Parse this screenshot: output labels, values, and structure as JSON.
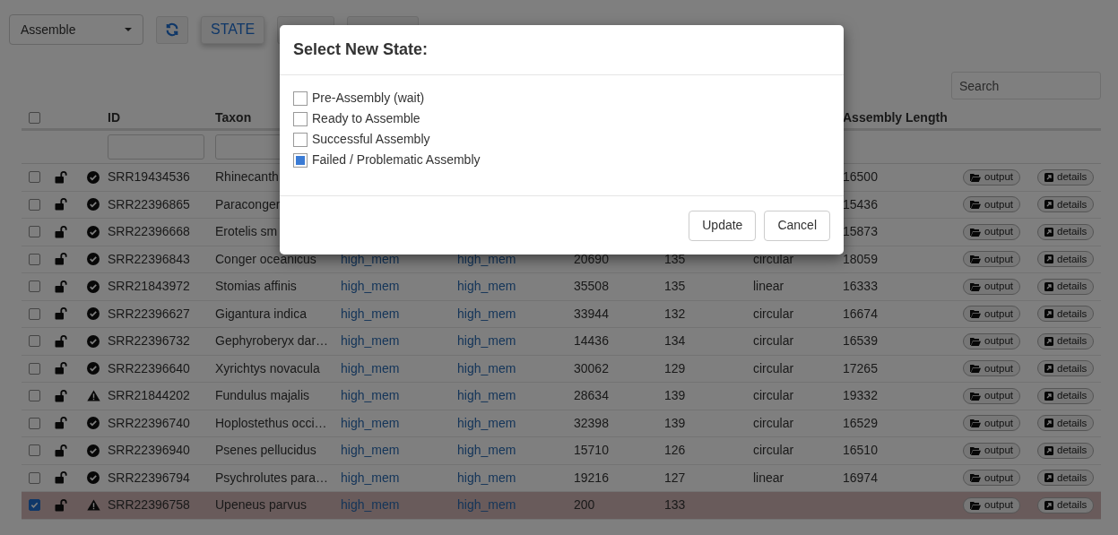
{
  "toolbar": {
    "mode_select": "Assemble",
    "buttons": [
      "STATE"
    ]
  },
  "search": {
    "placeholder": "Search"
  },
  "table": {
    "columns": {
      "id": "ID",
      "taxon": "Taxon",
      "assembly_length": "Assembly Length"
    },
    "select_all_checked": false,
    "rows": [
      {
        "selected": false,
        "locked": false,
        "warning": false,
        "id": "SRR19434536",
        "taxon": "Rhinecanth",
        "assembly_length": "16500",
        "output": "output",
        "details": "details"
      },
      {
        "selected": false,
        "locked": false,
        "warning": false,
        "id": "SRR22396865",
        "taxon": "Paraconger",
        "assembly_length": "15436",
        "output": "output",
        "details": "details"
      },
      {
        "selected": false,
        "locked": false,
        "warning": false,
        "id": "SRR22396668",
        "taxon": "Erotelis sm",
        "assembly_length": "15873",
        "output": "output",
        "details": "details"
      },
      {
        "selected": false,
        "locked": false,
        "warning": false,
        "id": "SRR22396843",
        "taxon": "Conger oceanicus",
        "column_6": "high_mem",
        "column_7": "high_mem",
        "column_8": "20690",
        "column_9": "135",
        "column_10": "circular",
        "assembly_length": "18059",
        "output": "output",
        "details": "details"
      },
      {
        "selected": false,
        "locked": false,
        "warning": false,
        "id": "SRR21843972",
        "taxon": "Stomias affinis",
        "column_6": "high_mem",
        "column_7": "high_mem",
        "column_8": "35508",
        "column_9": "135",
        "column_10": "linear",
        "assembly_length": "16333",
        "output": "output",
        "details": "details"
      },
      {
        "selected": false,
        "locked": false,
        "warning": false,
        "id": "SRR22396627",
        "taxon": "Gigantura indica",
        "column_6": "high_mem",
        "column_7": "high_mem",
        "column_8": "33944",
        "column_9": "132",
        "column_10": "circular",
        "assembly_length": "16674",
        "output": "output",
        "details": "details"
      },
      {
        "selected": false,
        "locked": false,
        "warning": false,
        "id": "SRR22396732",
        "taxon": "Gephyroberyx dar…",
        "column_6": "high_mem",
        "column_7": "high_mem",
        "column_8": "14436",
        "column_9": "134",
        "column_10": "circular",
        "assembly_length": "16539",
        "output": "output",
        "details": "details"
      },
      {
        "selected": false,
        "locked": false,
        "warning": false,
        "id": "SRR22396640",
        "taxon": "Xyrichtys novacula",
        "column_6": "high_mem",
        "column_7": "high_mem",
        "column_8": "30062",
        "column_9": "129",
        "column_10": "circular",
        "assembly_length": "17265",
        "output": "output",
        "details": "details"
      },
      {
        "selected": false,
        "locked": false,
        "warning": true,
        "id": "SRR21844202",
        "taxon": "Fundulus majalis",
        "column_6": "high_mem",
        "column_7": "high_mem",
        "column_8": "28634",
        "column_9": "139",
        "column_10": "circular",
        "assembly_length": "19332",
        "output": "output",
        "details": "details"
      },
      {
        "selected": false,
        "locked": false,
        "warning": false,
        "id": "SRR22396740",
        "taxon": "Hoplostethus occi…",
        "column_6": "high_mem",
        "column_7": "high_mem",
        "column_8": "32398",
        "column_9": "139",
        "column_10": "circular",
        "assembly_length": "16529",
        "output": "output",
        "details": "details"
      },
      {
        "selected": false,
        "locked": false,
        "warning": false,
        "id": "SRR22396940",
        "taxon": "Psenes pellucidus",
        "column_6": "high_mem",
        "column_7": "high_mem",
        "column_8": "15710",
        "column_9": "126",
        "column_10": "circular",
        "assembly_length": "16510",
        "output": "output",
        "details": "details"
      },
      {
        "selected": false,
        "locked": false,
        "warning": false,
        "id": "SRR22396794",
        "taxon": "Psychrolutes para…",
        "column_6": "high_mem",
        "column_7": "high_mem",
        "column_8": "19216",
        "column_9": "127",
        "column_10": "linear",
        "assembly_length": "16974",
        "output": "output",
        "details": "details"
      },
      {
        "selected": true,
        "locked": false,
        "warning": true,
        "id": "SRR22396758",
        "taxon": "Upeneus parvus",
        "column_6": "high_mem",
        "column_7": "high_mem",
        "column_8": "200",
        "column_9": "133",
        "output": "output",
        "details": "details"
      }
    ]
  },
  "modal": {
    "title": "Select New State:",
    "options": [
      {
        "label": "Pre-Assembly (wait)",
        "checked": false
      },
      {
        "label": "Ready to Assemble",
        "checked": false
      },
      {
        "label": "Successful Assembly",
        "checked": false
      },
      {
        "label": "Failed / Problematic Assembly",
        "checked": true
      }
    ],
    "buttons": [
      "Update",
      "Cancel"
    ]
  }
}
